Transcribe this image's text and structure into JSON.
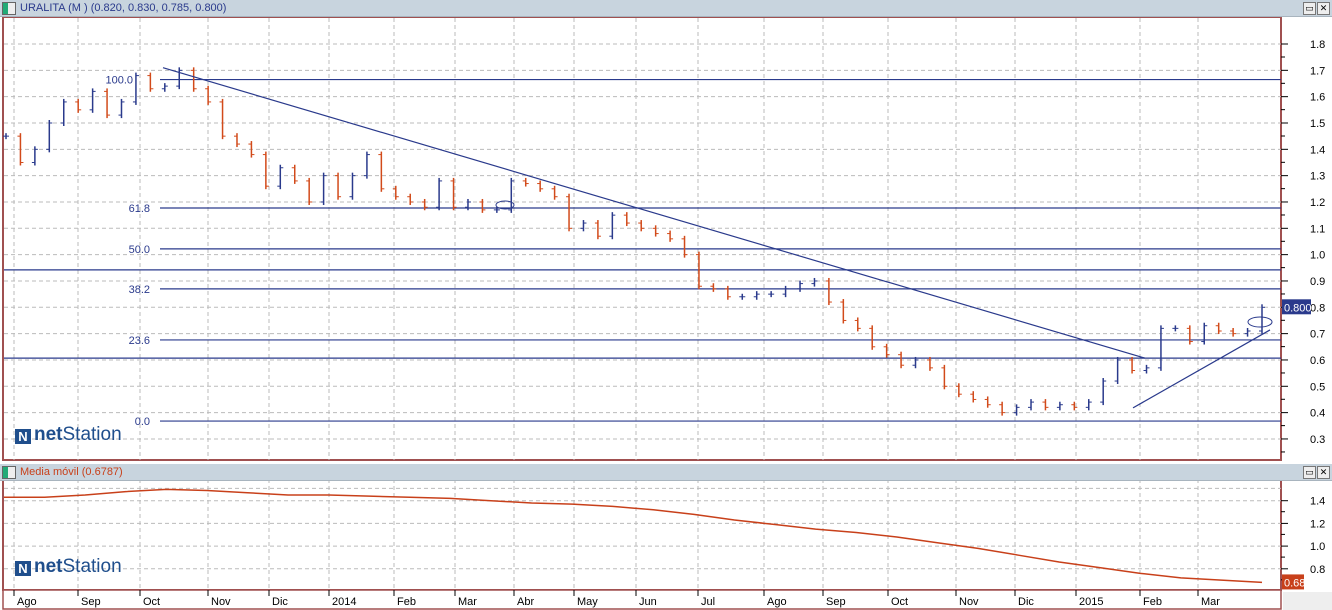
{
  "main_panel": {
    "title": "URALITA (M ) (0.820, 0.830, 0.785, 0.800)",
    "title_color": "#2a3a8c"
  },
  "lower_panel": {
    "title": "Media móvil (0.6787)",
    "title_color": "#c8401a"
  },
  "logo": {
    "mark": "N",
    "text_bold": "net",
    "text_rest": "Station"
  },
  "window_buttons": {
    "maximize": "▭",
    "close": "✕"
  },
  "colors": {
    "up_bar": "#2a3a8c",
    "down_bar": "#d24a1a",
    "lines": "#2a3a8c",
    "ma": "#c8401a",
    "frame": "#a05050",
    "grid": "#bbbbbb"
  },
  "chart_data": [
    {
      "type": "ohlc-bar",
      "title": "URALITA (M )",
      "ylim": [
        0.25,
        1.85
      ],
      "y_ticks": [
        "1.8",
        "1.7",
        "1.6",
        "1.5",
        "1.4",
        "1.3",
        "1.2",
        "1.1",
        "1.0",
        "0.9",
        "0.8",
        "0.7",
        "0.6",
        "0.5",
        "0.4",
        "0.3"
      ],
      "x_ticks": [
        "Ago",
        "Sep",
        "Oct",
        "Nov",
        "Dic",
        "2014",
        "Feb",
        "Mar",
        "Abr",
        "May",
        "Jun",
        "Jul",
        "Ago",
        "Sep",
        "Oct",
        "Nov",
        "Dic",
        "2015",
        "Feb",
        "Mar"
      ],
      "grid": true,
      "last_value_label": "0.800",
      "close": [
        1.45,
        1.35,
        1.4,
        1.5,
        1.58,
        1.55,
        1.62,
        1.53,
        1.58,
        1.68,
        1.63,
        1.64,
        1.7,
        1.63,
        1.58,
        1.45,
        1.42,
        1.38,
        1.26,
        1.33,
        1.28,
        1.2,
        1.3,
        1.22,
        1.3,
        1.38,
        1.25,
        1.22,
        1.2,
        1.18,
        1.28,
        1.18,
        1.2,
        1.17,
        1.17,
        1.28,
        1.27,
        1.25,
        1.22,
        1.1,
        1.12,
        1.07,
        1.15,
        1.12,
        1.1,
        1.08,
        1.06,
        1.0,
        0.88,
        0.87,
        0.84,
        0.84,
        0.85,
        0.85,
        0.87,
        0.89,
        0.9,
        0.82,
        0.75,
        0.72,
        0.65,
        0.62,
        0.58,
        0.6,
        0.57,
        0.5,
        0.47,
        0.45,
        0.43,
        0.4,
        0.42,
        0.44,
        0.42,
        0.43,
        0.42,
        0.44,
        0.52,
        0.6,
        0.56,
        0.57,
        0.72,
        0.72,
        0.67,
        0.73,
        0.71,
        0.7,
        0.71,
        0.8
      ],
      "fibonacci": [
        {
          "label": "100.0",
          "value": 1.665
        },
        {
          "label": "61.8",
          "value": 1.177
        },
        {
          "label": "50.0",
          "value": 1.022
        },
        {
          "label": "38.2",
          "value": 0.87
        },
        {
          "label": "23.6",
          "value": 0.676
        },
        {
          "label": "0.0",
          "value": 0.368
        }
      ],
      "horizontal_lines": [
        0.942,
        0.607
      ],
      "trend_lines": [
        {
          "from": {
            "month": "Oct 2013",
            "value": 1.71
          },
          "to": {
            "month": "Feb 2015",
            "value": 0.607
          }
        },
        {
          "from": {
            "month": "Ene 2015",
            "value": 0.418
          },
          "to": {
            "month": "Mar 2015",
            "value": 0.714
          }
        }
      ]
    },
    {
      "type": "line",
      "title": "Media móvil (0.6787)",
      "ylim": [
        0.66,
        1.56
      ],
      "y_ticks": [
        "1.4",
        "1.2",
        "1.0",
        "0.8"
      ],
      "grid": true,
      "last_value_label": "0.68",
      "values": [
        1.43,
        1.43,
        1.45,
        1.48,
        1.5,
        1.49,
        1.47,
        1.45,
        1.45,
        1.44,
        1.43,
        1.42,
        1.4,
        1.38,
        1.37,
        1.35,
        1.32,
        1.28,
        1.23,
        1.19,
        1.15,
        1.12,
        1.08,
        1.03,
        0.98,
        0.92,
        0.86,
        0.81,
        0.76,
        0.72,
        0.7,
        0.68
      ]
    }
  ]
}
